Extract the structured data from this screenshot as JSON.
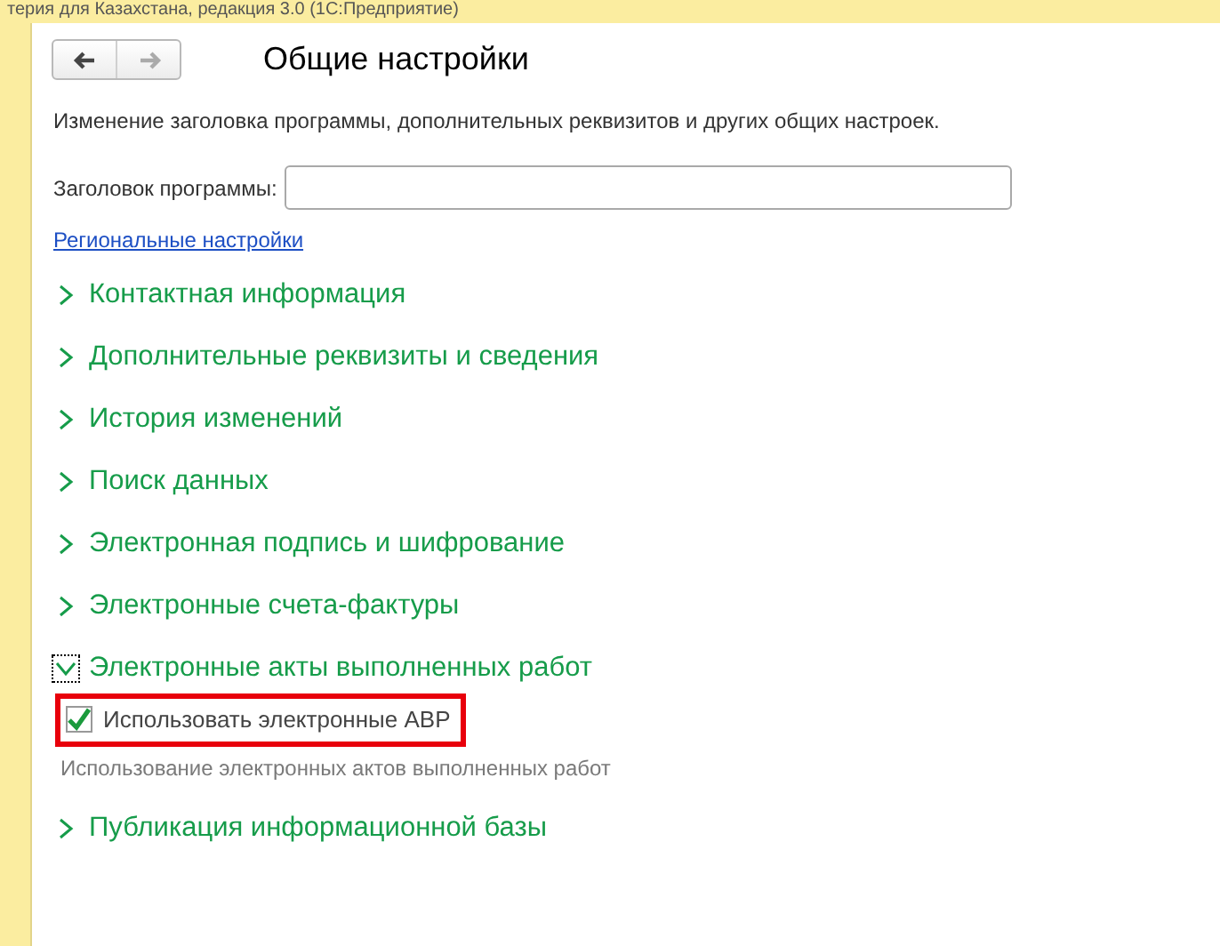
{
  "window": {
    "title": "терия для Казахстана, редакция 3.0  (1С:Предприятие)"
  },
  "navigation": {
    "back_enabled": true,
    "forward_enabled": false
  },
  "page": {
    "title": "Общие настройки",
    "description": "Изменение заголовка программы, дополнительных реквизитов и других общих настроек."
  },
  "program_title_field": {
    "label": "Заголовок программы:"
  },
  "regional_link": "Региональные настройки",
  "sections": [
    {
      "title": "Контактная информация",
      "expanded": false
    },
    {
      "title": "Дополнительные реквизиты и сведения",
      "expanded": false
    },
    {
      "title": "История изменений",
      "expanded": false
    },
    {
      "title": "Поиск данных",
      "expanded": false
    },
    {
      "title": "Электронная подпись и шифрование",
      "expanded": false
    },
    {
      "title": "Электронные счета-фактуры",
      "expanded": false
    },
    {
      "title": "Электронные акты выполненных работ",
      "expanded": true,
      "options": [
        {
          "label": "Использовать электронные АВР",
          "checked": true,
          "highlighted": true
        }
      ],
      "note": "Использование электронных актов выполненных работ"
    },
    {
      "title": "Публикация информационной базы",
      "expanded": false
    }
  ]
}
